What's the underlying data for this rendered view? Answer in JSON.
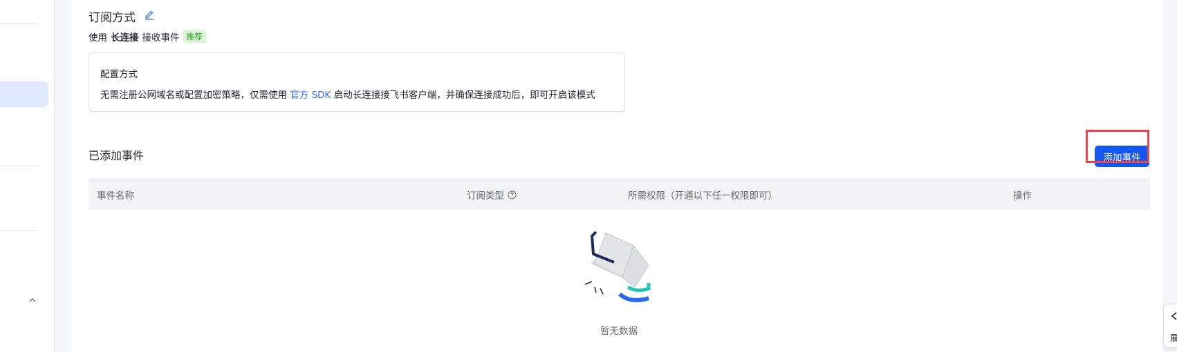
{
  "subscription": {
    "title": "订阅方式",
    "use_prefix": "使用",
    "use_mode": "长连接",
    "use_suffix": "接收事件",
    "recommend_tag": "推荐"
  },
  "config": {
    "title": "配置方式",
    "desc_before": "无需注册公网域名或配置加密策略，仅需使用",
    "desc_link": "官方 SDK",
    "desc_after": "启动长连接接飞书客户端，并确保连接成功后，即可开启该模式"
  },
  "events": {
    "title": "已添加事件",
    "add_button": "添加事件",
    "columns": {
      "name": "事件名称",
      "type": "订阅类型",
      "permission": "所需权限（开通以下任一权限即可）",
      "action": "操作"
    },
    "empty_text": "暂无数据"
  },
  "float_panel": {
    "label": "展"
  },
  "colors": {
    "primary": "#1456f0",
    "link": "#3370ff",
    "tag_bg": "#d9f5d6",
    "tag_text": "#2ea121",
    "highlight": "#e8474a"
  }
}
